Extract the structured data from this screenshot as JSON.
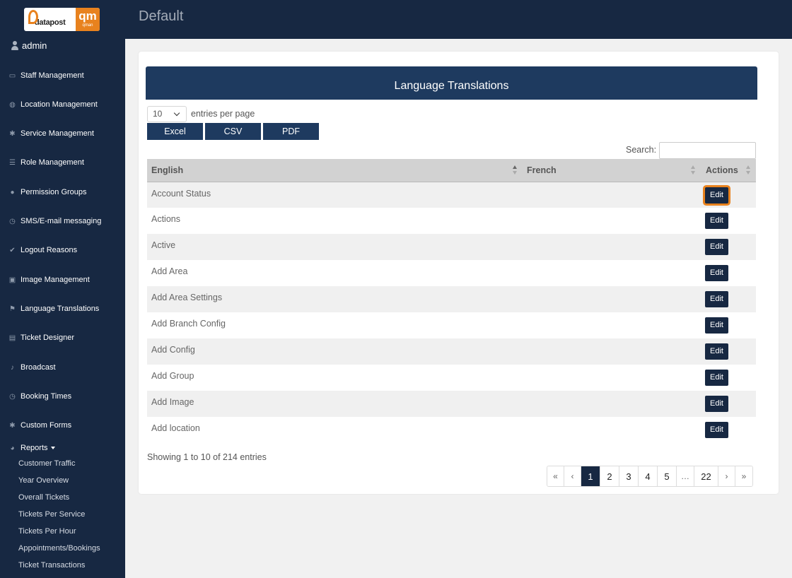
{
  "logo": {
    "brand_left": "datapost",
    "brand_right": "qm",
    "brand_right_sub": "qman"
  },
  "header": {
    "title": "Default"
  },
  "user": {
    "name": "admin"
  },
  "sidebar": {
    "items": [
      {
        "label": "Staff Management",
        "icon": "id-card-icon"
      },
      {
        "label": "Location Management",
        "icon": "globe-icon"
      },
      {
        "label": "Service Management",
        "icon": "gear-icon"
      },
      {
        "label": "Role Management",
        "icon": "list-icon"
      },
      {
        "label": "Permission Groups",
        "icon": "users-icon"
      },
      {
        "label": "SMS/E-mail messaging",
        "icon": "clock-icon"
      },
      {
        "label": "Logout Reasons",
        "icon": "check-icon"
      },
      {
        "label": "Image Management",
        "icon": "image-icon"
      },
      {
        "label": "Language Translations",
        "icon": "flag-icon"
      },
      {
        "label": "Ticket Designer",
        "icon": "ticket-icon"
      },
      {
        "label": "Broadcast",
        "icon": "bell-icon"
      },
      {
        "label": "Booking Times",
        "icon": "clock-icon"
      },
      {
        "label": "Custom Forms",
        "icon": "gear-icon"
      }
    ],
    "reports": {
      "label": "Reports",
      "children": [
        "Customer Traffic",
        "Year Overview",
        "Overall Tickets",
        "Tickets Per Service",
        "Tickets Per Hour",
        "Appointments/Bookings",
        "Ticket Transactions"
      ]
    }
  },
  "card": {
    "title": "Language Translations",
    "page_length": "10",
    "page_length_label": "entries per page",
    "export_buttons": [
      "Excel",
      "CSV",
      "PDF"
    ],
    "search_label": "Search:",
    "search_value": ""
  },
  "table": {
    "columns": [
      "English",
      "French",
      "Actions"
    ],
    "rows": [
      {
        "english": "Account Status",
        "french": "",
        "action": "Edit"
      },
      {
        "english": "Actions",
        "french": "",
        "action": "Edit"
      },
      {
        "english": "Active",
        "french": "",
        "action": "Edit"
      },
      {
        "english": "Add Area",
        "french": "",
        "action": "Edit"
      },
      {
        "english": "Add Area Settings",
        "french": "",
        "action": "Edit"
      },
      {
        "english": "Add Branch Config",
        "french": "",
        "action": "Edit"
      },
      {
        "english": "Add Config",
        "french": "",
        "action": "Edit"
      },
      {
        "english": "Add Group",
        "french": "",
        "action": "Edit"
      },
      {
        "english": "Add Image",
        "french": "",
        "action": "Edit"
      },
      {
        "english": "Add location",
        "french": "",
        "action": "Edit"
      }
    ]
  },
  "info": "Showing 1 to 10 of 214 entries",
  "pagination": {
    "first": "«",
    "prev": "‹",
    "pages": [
      "1",
      "2",
      "3",
      "4",
      "5",
      "…",
      "22"
    ],
    "current": "1",
    "next": "›",
    "last": "»"
  },
  "colors": {
    "sidebar": "#172842",
    "accent": "#1e3a5f",
    "focus": "#e8821e"
  }
}
